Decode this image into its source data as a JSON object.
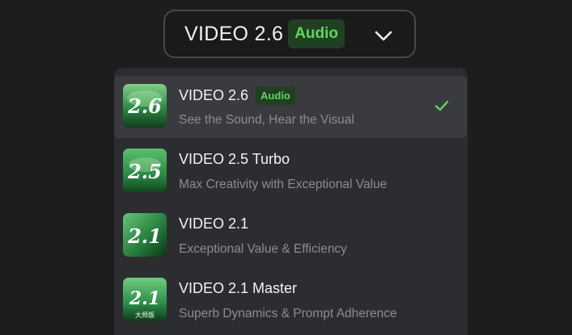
{
  "selector": {
    "title": "VIDEO 2.6",
    "badge": "Audio",
    "chevron_icon": "chevron-down-icon"
  },
  "options": [
    {
      "title": "VIDEO 2.6",
      "badge": "Audio",
      "subtitle": "See the Sound, Hear the Visual",
      "thumb_label": "2.6",
      "selected": true
    },
    {
      "title": "VIDEO 2.5 Turbo",
      "subtitle": "Max Creativity with Exceptional Value",
      "thumb_label": "2.5",
      "selected": false
    },
    {
      "title": "VIDEO 2.1",
      "subtitle": "Exceptional Value & Efficiency",
      "thumb_label": "2.1",
      "selected": false
    },
    {
      "title": "VIDEO 2.1 Master",
      "subtitle": "Superb Dynamics & Prompt Adherence",
      "thumb_label": "2.1",
      "thumb_caption": "大师版",
      "selected": false
    }
  ],
  "colors": {
    "accent_green": "#5fd85d",
    "badge_bg": "#213f22",
    "panel_bg": "#2c2d30",
    "selected_bg": "#3a3b3f"
  }
}
